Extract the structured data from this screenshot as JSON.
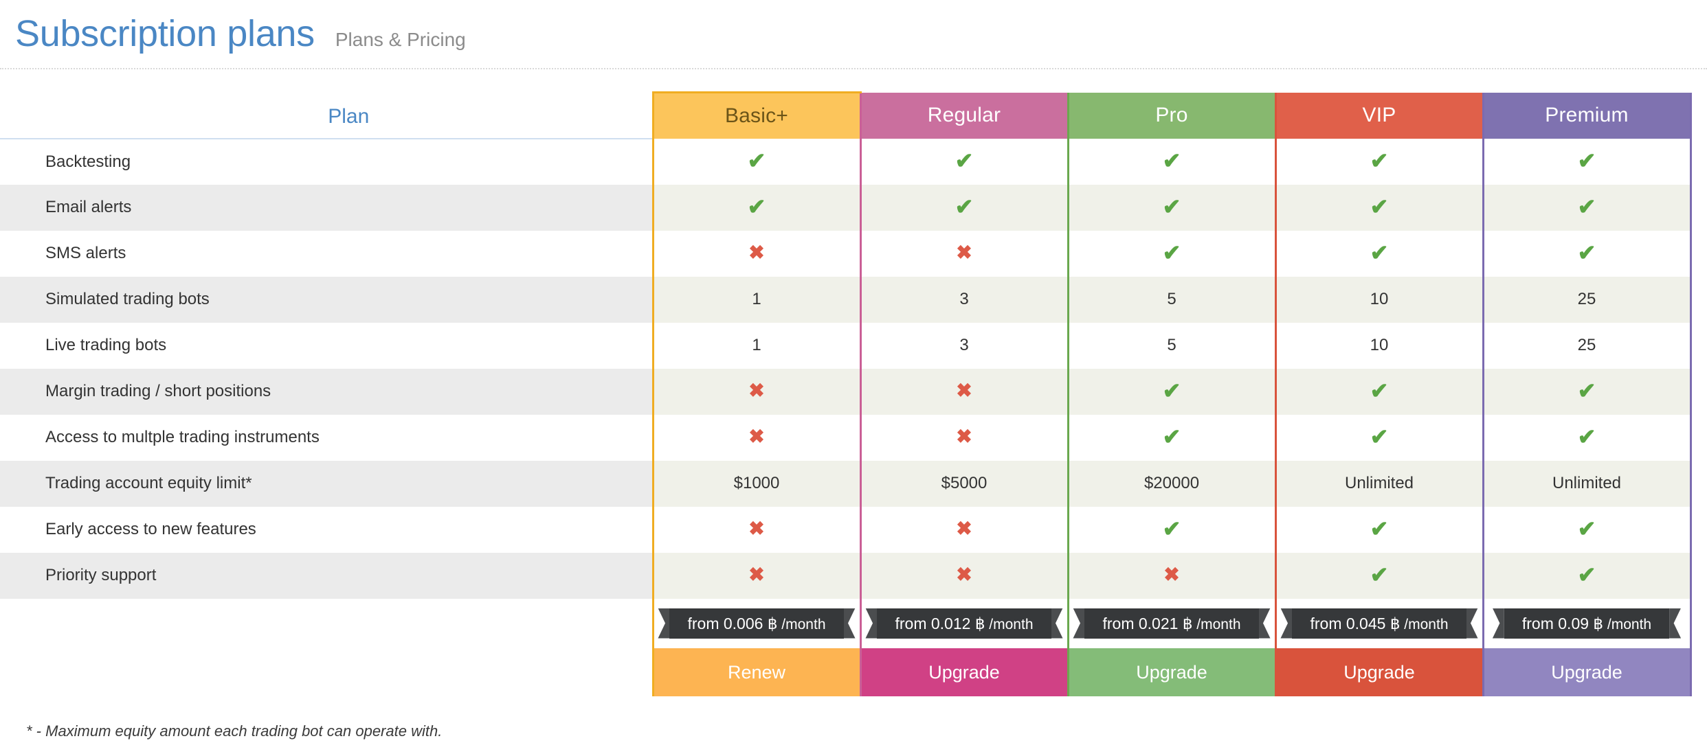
{
  "header": {
    "title": "Subscription plans",
    "subtitle": "Plans & Pricing",
    "title_color": "#4a87c4",
    "subtitle_color": "#8b8b8b"
  },
  "table": {
    "feature_column_header": "Plan",
    "plans": [
      {
        "name": "Basic+",
        "header_bg": "#fcc55b",
        "accent": "#f0ad22",
        "button_bg": "#fdb452",
        "header_text_color": "#6b5418",
        "price": "from 0.006 ฿",
        "price_period": "/month",
        "cta": "Renew"
      },
      {
        "name": "Regular",
        "header_bg": "#ca6f9e",
        "accent": "#ca5f96",
        "button_bg": "#d04185",
        "header_text_color": "#ffffff",
        "price": "from 0.012 ฿",
        "price_period": "/month",
        "cta": "Upgrade"
      },
      {
        "name": "Pro",
        "header_bg": "#87b86f",
        "accent": "#6aa84f",
        "button_bg": "#84bc78",
        "header_text_color": "#ffffff",
        "price": "from 0.021 ฿",
        "price_period": "/month",
        "cta": "Upgrade"
      },
      {
        "name": "VIP",
        "header_bg": "#e0604a",
        "accent": "#d9533c",
        "button_bg": "#d9533c",
        "header_text_color": "#ffffff",
        "price": "from 0.045 ฿",
        "price_period": "/month",
        "cta": "Upgrade"
      },
      {
        "name": "Premium",
        "header_bg": "#7f72b0",
        "accent": "#7b6bb0",
        "button_bg": "#9186c0",
        "header_text_color": "#ffffff",
        "price": "from 0.09 ฿",
        "price_period": "/month",
        "cta": "Upgrade"
      }
    ],
    "rows": [
      {
        "feature": "Backtesting",
        "values": [
          "yes",
          "yes",
          "yes",
          "yes",
          "yes"
        ]
      },
      {
        "feature": "Email alerts",
        "values": [
          "yes",
          "yes",
          "yes",
          "yes",
          "yes"
        ]
      },
      {
        "feature": "SMS alerts",
        "values": [
          "no",
          "no",
          "yes",
          "yes",
          "yes"
        ]
      },
      {
        "feature": "Simulated trading bots",
        "values": [
          "1",
          "3",
          "5",
          "10",
          "25"
        ]
      },
      {
        "feature": "Live trading bots",
        "values": [
          "1",
          "3",
          "5",
          "10",
          "25"
        ]
      },
      {
        "feature": "Margin trading / short positions",
        "values": [
          "no",
          "no",
          "yes",
          "yes",
          "yes"
        ]
      },
      {
        "feature": "Access to multple trading instruments",
        "values": [
          "no",
          "no",
          "yes",
          "yes",
          "yes"
        ]
      },
      {
        "feature": "Trading account equity limit*",
        "values": [
          "$1000",
          "$5000",
          "$20000",
          "Unlimited",
          "Unlimited"
        ]
      },
      {
        "feature": "Early access to new features",
        "values": [
          "no",
          "no",
          "yes",
          "yes",
          "yes"
        ]
      },
      {
        "feature": "Priority support",
        "values": [
          "no",
          "no",
          "no",
          "yes",
          "yes"
        ]
      }
    ],
    "icons": {
      "yes": "✔",
      "no": "✖",
      "yes_color": "#5aa544",
      "no_color": "#dd5a47"
    }
  },
  "footnote": "* - Maximum equity amount each trading bot can operate with."
}
